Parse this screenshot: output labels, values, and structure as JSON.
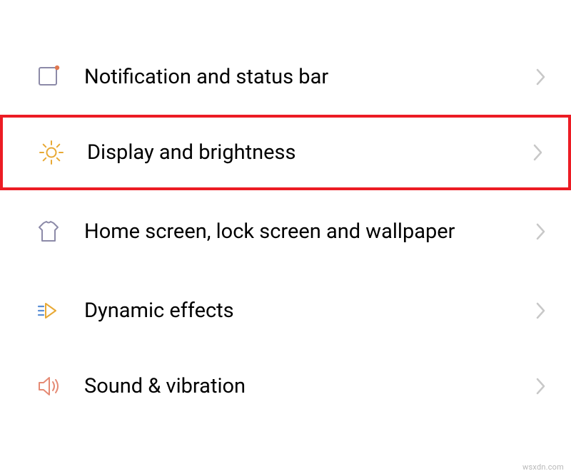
{
  "settings": {
    "items": [
      {
        "label": "Notification and status bar"
      },
      {
        "label": "Display and brightness"
      },
      {
        "label": "Home screen, lock screen and wallpaper"
      },
      {
        "label": "Dynamic effects"
      },
      {
        "label": "Sound & vibration"
      }
    ]
  },
  "watermark": "wsxdn.com"
}
